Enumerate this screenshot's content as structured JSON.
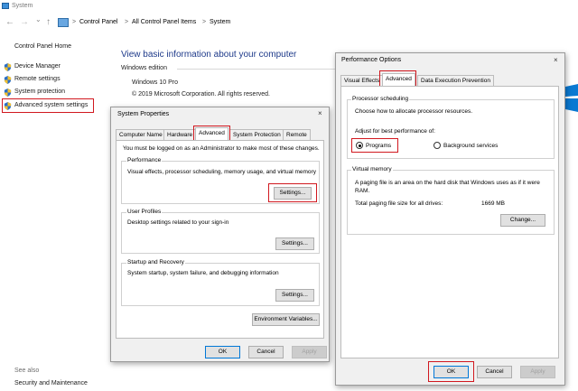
{
  "window": {
    "title": "System",
    "nav": {
      "back": "←",
      "forward": "→",
      "dropdown": "⌄",
      "up": "↑"
    },
    "breadcrumbs": [
      "Control Panel",
      "All Control Panel Items",
      "System"
    ],
    "crumb_sep": ">"
  },
  "sidebar": {
    "home": "Control Panel Home",
    "items": [
      {
        "label": "Device Manager"
      },
      {
        "label": "Remote settings"
      },
      {
        "label": "System protection"
      },
      {
        "label": "Advanced system settings"
      }
    ],
    "see_also": "See also",
    "security": "Security and Maintenance"
  },
  "main": {
    "title": "View basic information about your computer",
    "windows_edition_label": "Windows edition",
    "edition": "Windows 10 Pro",
    "copyright": "© 2019 Microsoft Corporation. All rights reserved."
  },
  "system_properties": {
    "title": "System Properties",
    "close": "×",
    "tabs": [
      "Computer Name",
      "Hardware",
      "Advanced",
      "System Protection",
      "Remote"
    ],
    "admin_note": "You must be logged on as an Administrator to make most of these changes.",
    "performance": {
      "title": "Performance",
      "desc": "Visual effects, processor scheduling, memory usage, and virtual memory",
      "button": "Settings..."
    },
    "user_profiles": {
      "title": "User Profiles",
      "desc": "Desktop settings related to your sign-in",
      "button": "Settings..."
    },
    "startup": {
      "title": "Startup and Recovery",
      "desc": "System startup, system failure, and debugging information",
      "button": "Settings..."
    },
    "env_button": "Environment Variables...",
    "ok": "OK",
    "cancel": "Cancel",
    "apply": "Apply"
  },
  "performance_options": {
    "title": "Performance Options",
    "close": "×",
    "tabs": [
      "Visual Effects",
      "Advanced",
      "Data Execution Prevention"
    ],
    "processor": {
      "title": "Processor scheduling",
      "desc": "Choose how to allocate processor resources.",
      "adjust": "Adjust for best performance of:",
      "programs": "Programs",
      "background": "Background services",
      "selected": "Programs"
    },
    "virtual_memory": {
      "title": "Virtual memory",
      "desc": "A paging file is an area on the hard disk that Windows uses as if it were RAM.",
      "total_label": "Total paging file size for all drives:",
      "total_value": "1669 MB",
      "button": "Change..."
    },
    "ok": "OK",
    "cancel": "Cancel",
    "apply": "Apply"
  },
  "colors": {
    "highlight": "#d1181f",
    "link": "#1e3a8a",
    "accent": "#0078d7"
  }
}
